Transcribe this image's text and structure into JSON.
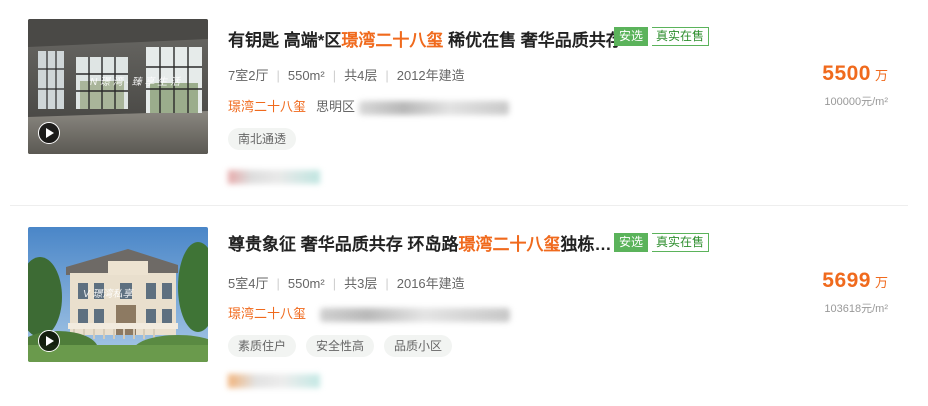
{
  "listings": [
    {
      "title_parts": [
        "有钥匙 高端*区",
        "璟湾二十八玺",
        " 稀优在售 奢华品质共存"
      ],
      "tags": [
        "安选",
        "真实在售"
      ],
      "meta": [
        "7室2厅",
        "550m²",
        "共4层",
        "2012年建造"
      ],
      "community": "璟湾二十八玺",
      "district": "思明区",
      "feature_tags": [
        "南北通透"
      ],
      "price_value": "5500",
      "price_unit": "万",
      "unit_price": "100000元/m²",
      "thumb_watermark": "N 璟 湾 · 臻 享 生 活",
      "has_video": true
    },
    {
      "title_parts": [
        "尊贵象征 奢华品质共存 环岛路",
        "璟湾二十八玺",
        "独栋…"
      ],
      "tags": [
        "安选",
        "真实在售"
      ],
      "meta": [
        "5室4厅",
        "550m²",
        "共3层",
        "2016年建造"
      ],
      "community": "璟湾二十八玺",
      "district": "",
      "feature_tags": [
        "素质住户",
        "安全性高",
        "品质小区"
      ],
      "price_value": "5699",
      "price_unit": "万",
      "unit_price": "103618元/m²",
      "thumb_watermark": "V 璟湾私享",
      "has_video": true
    }
  ],
  "colors": {
    "accent": "#f06a1d",
    "tag_green": "#5bb35b",
    "text_dark": "#222222",
    "text_gray": "#666666"
  },
  "icons": [
    "play-icon"
  ]
}
